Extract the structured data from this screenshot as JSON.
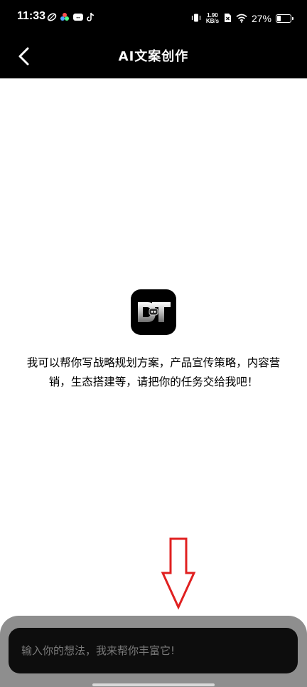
{
  "status_bar": {
    "time": "11:33",
    "net_speed_value": "1.90",
    "net_speed_unit": "KB/s",
    "battery_percent": "27%",
    "battery_level": 0.27
  },
  "nav": {
    "title": "AI文案创作"
  },
  "intro": {
    "text": "我可以帮你写战略规划方案，产品宣传策略，内容营销，生态搭建等，请把你的任务交给我吧！"
  },
  "input": {
    "placeholder": "输入你的想法，我来帮你丰富它!"
  },
  "colors": {
    "header_bg": "#000000",
    "arrow_red": "#e02020",
    "panel_bg": "#8e8e8e",
    "input_bg": "#0d0d0d"
  }
}
